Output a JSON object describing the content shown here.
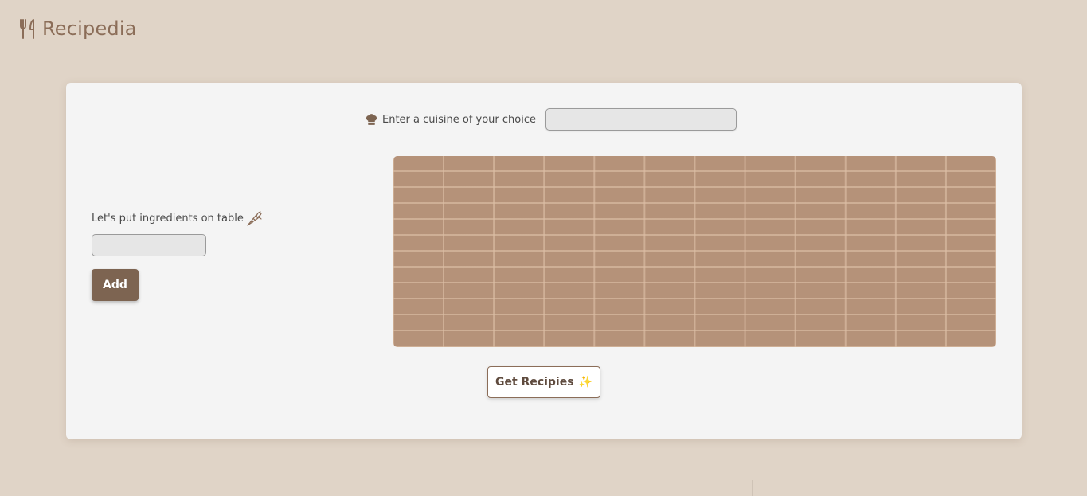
{
  "header": {
    "title": "Recipedia",
    "icon": "fork-knife-icon"
  },
  "cuisine": {
    "label": "Enter a cuisine of your choice",
    "icon": "chef-hat-icon",
    "value": "",
    "placeholder": ""
  },
  "ingredients": {
    "label": "Let's put ingredients on table",
    "icon": "carrot-icon",
    "value": "",
    "placeholder": "",
    "add_label": "Add"
  },
  "table": {
    "ingredients": []
  },
  "actions": {
    "get_recipes_label": "Get Recipies",
    "sparkle_glyph": "✨"
  },
  "colors": {
    "page_bg": "#e0d4c7",
    "card_bg": "#f4f4f4",
    "accent_brown": "#7d6451",
    "brand_text": "#8b6d58",
    "table_wood": "#b59279"
  }
}
